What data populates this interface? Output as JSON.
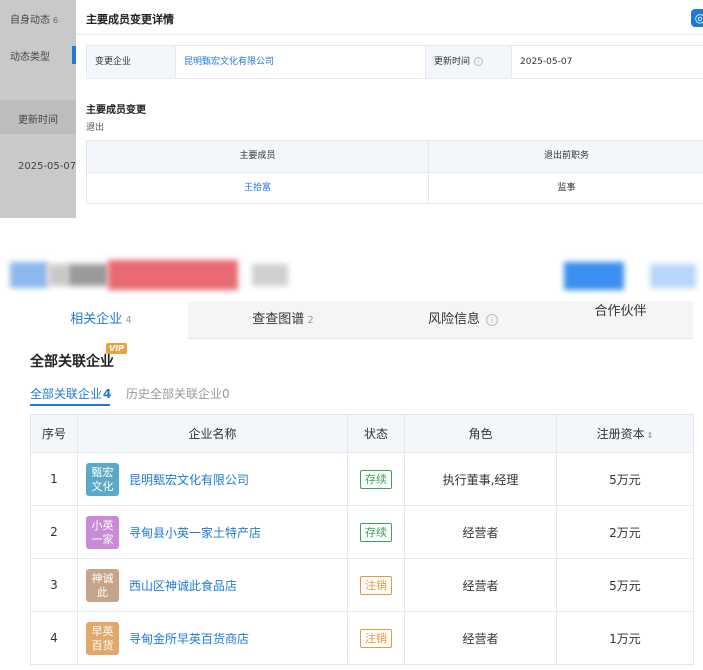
{
  "left_panel": {
    "title": "自身动态",
    "title_count": "6",
    "filter_label": "动态类型",
    "update_time_label": "更新时间",
    "update_time_value": "2025-05-07"
  },
  "modal": {
    "title": "主要成员变更详情",
    "change_company_label": "变更企业",
    "change_company_value": "昆明甄宏文化有限公司",
    "update_time_label": "更新时间",
    "update_time_value": "2025-05-07",
    "section_title": "主要成员变更",
    "section_sub": "退出",
    "table": {
      "headers": [
        "主要成员",
        "退出前职务"
      ],
      "rows": [
        [
          "王拾富",
          "监事"
        ]
      ]
    }
  },
  "tabs": [
    {
      "label": "相关企业",
      "count": "4"
    },
    {
      "label": "查查图谱",
      "count": "2"
    },
    {
      "label": "风险信息",
      "count": ""
    },
    {
      "label": "合作伙伴",
      "count": ""
    }
  ],
  "related": {
    "title": "全部关联企业",
    "vip": "VIP",
    "subtabs": [
      {
        "label": "全部关联企业",
        "count": "4"
      },
      {
        "label": "历史全部关联企业",
        "count": "0"
      }
    ],
    "headers": [
      "序号",
      "企业名称",
      "状态",
      "角色",
      "注册资本"
    ],
    "rows": [
      {
        "no": "1",
        "logo": [
          "甄宏",
          "文化"
        ],
        "logo_color": "#5aa9c9",
        "name": "昆明甄宏文化有限公司",
        "status": "存续",
        "status_color": "#3aa35a",
        "role": "执行董事,经理",
        "capital": "5万元"
      },
      {
        "no": "2",
        "logo": [
          "小英",
          "一家"
        ],
        "logo_color": "#c98ad6",
        "name": "寻甸县小英一家土特产店",
        "status": "存续",
        "status_color": "#3aa35a",
        "role": "经营者",
        "capital": "2万元"
      },
      {
        "no": "3",
        "logo": [
          "神诚",
          "此"
        ],
        "logo_color": "#c5a489",
        "name": "西山区神诚此食品店",
        "status": "注销",
        "status_color": "#e8973b",
        "role": "经营者",
        "capital": "5万元"
      },
      {
        "no": "4",
        "logo": [
          "早英",
          "百货"
        ],
        "logo_color": "#e0a86a",
        "name": "寻甸金所早英百货商店",
        "status": "注销",
        "status_color": "#e8973b",
        "role": "经营者",
        "capital": "1万元"
      }
    ]
  },
  "colors": {
    "accent": "#1f7ad6",
    "active_status": "#3aa35a",
    "cancelled_status": "#e8973b"
  }
}
